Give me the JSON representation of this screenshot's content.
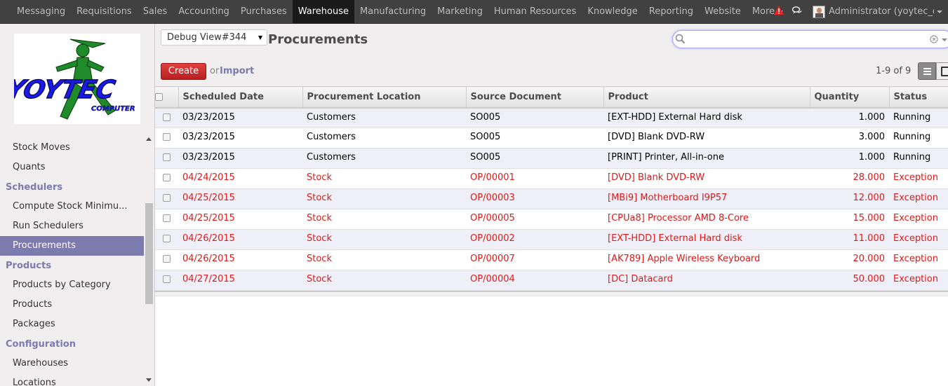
{
  "topnav": {
    "items": [
      "Messaging",
      "Requisitions",
      "Sales",
      "Accounting",
      "Purchases",
      "Warehouse",
      "Manufacturing",
      "Marketing",
      "Human Resources",
      "Knowledge",
      "Reporting",
      "Website",
      "More"
    ],
    "active": "Warehouse",
    "user": "Administrator (yoytec_d...",
    "icons": [
      "warning-icon",
      "chat-icon",
      "avatar"
    ]
  },
  "sidebar": {
    "logo_text": "YOYTEC COMPUTER",
    "items": [
      {
        "type": "item",
        "label": "Stock Moves"
      },
      {
        "type": "item",
        "label": "Quants"
      },
      {
        "type": "section",
        "label": "Schedulers"
      },
      {
        "type": "item",
        "label": "Compute Stock Minimu..."
      },
      {
        "type": "item",
        "label": "Run Schedulers"
      },
      {
        "type": "item",
        "label": "Procurements",
        "active": true
      },
      {
        "type": "section",
        "label": "Products"
      },
      {
        "type": "item",
        "label": "Products by Category"
      },
      {
        "type": "item",
        "label": "Products"
      },
      {
        "type": "item",
        "label": "Packages"
      },
      {
        "type": "section",
        "label": "Configuration"
      },
      {
        "type": "item",
        "label": "Warehouses"
      },
      {
        "type": "item",
        "label": "Locations"
      }
    ]
  },
  "header": {
    "debug_select": "Debug View#344",
    "title": "Procurements",
    "search_value": "",
    "create_label": "Create",
    "or_label": "or",
    "import_label": "Import",
    "pager": "1-9 of 9"
  },
  "table": {
    "columns": [
      "Scheduled Date",
      "Procurement Location",
      "Source Document",
      "Product",
      "Quantity",
      "Status"
    ],
    "rows": [
      {
        "date": "03/23/2015",
        "location": "Customers",
        "source": "SO005",
        "product": "[EXT-HDD] External Hard disk",
        "qty": "1.000",
        "status": "Running"
      },
      {
        "date": "03/23/2015",
        "location": "Customers",
        "source": "SO005",
        "product": "[DVD] Blank DVD-RW",
        "qty": "3.000",
        "status": "Running"
      },
      {
        "date": "03/23/2015",
        "location": "Customers",
        "source": "SO005",
        "product": "[PRINT] Printer, All-in-one",
        "qty": "1.000",
        "status": "Running"
      },
      {
        "date": "04/24/2015",
        "location": "Stock",
        "source": "OP/00001",
        "product": "[DVD] Blank DVD-RW",
        "qty": "28.000",
        "status": "Exception"
      },
      {
        "date": "04/25/2015",
        "location": "Stock",
        "source": "OP/00003",
        "product": "[MBi9] Motherboard I9P57",
        "qty": "12.000",
        "status": "Exception"
      },
      {
        "date": "04/25/2015",
        "location": "Stock",
        "source": "OP/00005",
        "product": "[CPUa8] Processor AMD 8-Core",
        "qty": "15.000",
        "status": "Exception"
      },
      {
        "date": "04/26/2015",
        "location": "Stock",
        "source": "OP/00002",
        "product": "[EXT-HDD] External Hard disk",
        "qty": "11.000",
        "status": "Exception"
      },
      {
        "date": "04/26/2015",
        "location": "Stock",
        "source": "OP/00007",
        "product": "[AK789] Apple Wireless Keyboard",
        "qty": "20.000",
        "status": "Exception"
      },
      {
        "date": "04/27/2015",
        "location": "Stock",
        "source": "OP/00004",
        "product": "[DC] Datacard",
        "qty": "50.000",
        "status": "Exception"
      }
    ]
  },
  "colors": {
    "topbar": "#414141",
    "accent": "#7c7bad",
    "create_button": "#dc3030",
    "exception_text": "#e01818"
  }
}
